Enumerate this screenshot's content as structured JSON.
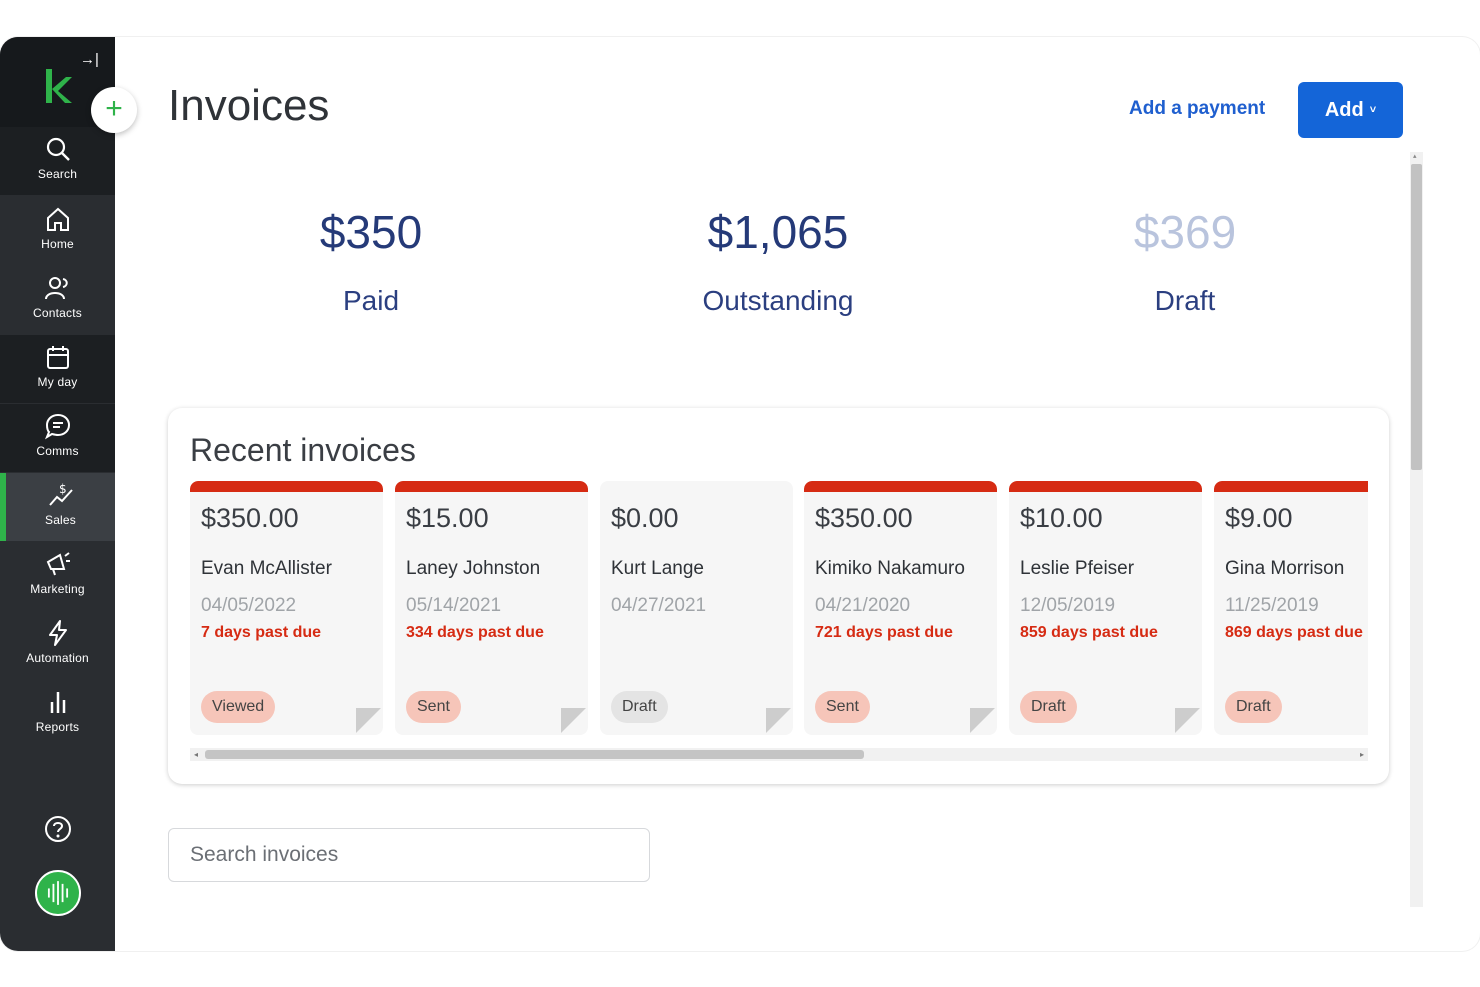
{
  "brand": {
    "logo": "k-logo-icon",
    "accent": "#2fb34a"
  },
  "sidebar": {
    "collapse_glyph": "→|",
    "items": [
      {
        "label": "Search",
        "icon": "search-icon"
      },
      {
        "label": "Home",
        "icon": "home-icon"
      },
      {
        "label": "Contacts",
        "icon": "contacts-icon"
      },
      {
        "label": "My day",
        "icon": "calendar-icon"
      },
      {
        "label": "Comms",
        "icon": "chat-icon"
      },
      {
        "label": "Sales",
        "icon": "sales-icon",
        "active": true
      },
      {
        "label": "Marketing",
        "icon": "megaphone-icon"
      },
      {
        "label": "Automation",
        "icon": "lightning-icon"
      },
      {
        "label": "Reports",
        "icon": "bar-chart-icon"
      }
    ]
  },
  "fab": {
    "glyph": "+"
  },
  "header": {
    "title": "Invoices",
    "add_payment_label": "Add a payment",
    "add_label": "Add",
    "add_chevron": "˅",
    "add_color": "#1465d8"
  },
  "summary": {
    "paid": {
      "amount": "$350",
      "label": "Paid"
    },
    "outstanding": {
      "amount": "$1,065",
      "label": "Outstanding"
    },
    "draft": {
      "amount": "$369",
      "label": "Draft"
    }
  },
  "recent": {
    "title": "Recent invoices",
    "cards": [
      {
        "amount": "$350.00",
        "name": "Evan McAllister",
        "date": "04/05/2022",
        "due": "7 days past due",
        "status": "Viewed",
        "flagged": true
      },
      {
        "amount": "$15.00",
        "name": "Laney Johnston",
        "date": "05/14/2021",
        "due": "334 days past due",
        "status": "Sent",
        "flagged": true
      },
      {
        "amount": "$0.00",
        "name": "Kurt Lange",
        "date": "04/27/2021",
        "due": "",
        "status": "Draft",
        "flagged": false
      },
      {
        "amount": "$350.00",
        "name": "Kimiko Nakamuro",
        "date": "04/21/2020",
        "due": "721 days past due",
        "status": "Sent",
        "flagged": true
      },
      {
        "amount": "$10.00",
        "name": "Leslie Pfeiser",
        "date": "12/05/2019",
        "due": "859 days past due",
        "status": "Draft",
        "flagged": true
      },
      {
        "amount": "$9.00",
        "name": "Gina Morrison",
        "date": "11/25/2019",
        "due": "869 days past due",
        "status": "Draft",
        "flagged": true
      }
    ],
    "overdue_color": "#d62b13"
  },
  "search": {
    "placeholder": "Search invoices"
  }
}
